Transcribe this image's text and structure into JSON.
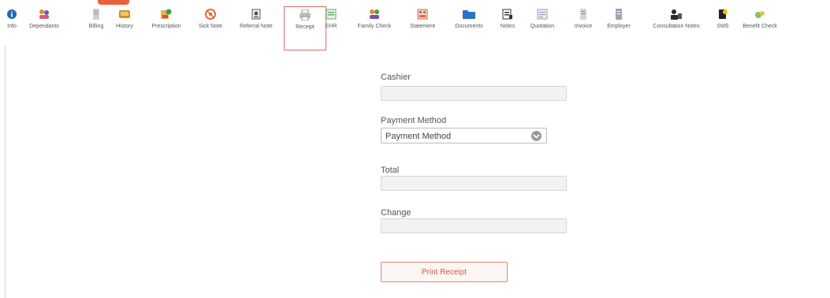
{
  "toolbar": {
    "items": [
      {
        "label": "Info",
        "icon": "info-icon"
      },
      {
        "label": "Dependants",
        "icon": "dependants-icon"
      },
      {
        "label": "Billing",
        "icon": "billing-icon"
      },
      {
        "label": "History",
        "icon": "history-icon"
      },
      {
        "label": "Prescription",
        "icon": "prescription-icon"
      },
      {
        "label": "Sick Note",
        "icon": "sick-note-icon"
      },
      {
        "label": "Referral Note",
        "icon": "referral-note-icon"
      },
      {
        "label": "Receipt",
        "icon": "receipt-icon"
      },
      {
        "label": "EHR",
        "icon": "ehr-icon"
      },
      {
        "label": "Family Check",
        "icon": "family-check-icon"
      },
      {
        "label": "Statement",
        "icon": "statement-icon"
      },
      {
        "label": "Documents",
        "icon": "documents-icon"
      },
      {
        "label": "Notes",
        "icon": "notes-icon"
      },
      {
        "label": "Quotation",
        "icon": "quotation-icon"
      },
      {
        "label": "Invoice",
        "icon": "invoice-icon"
      },
      {
        "label": "Employer",
        "icon": "employer-icon"
      },
      {
        "label": "Consultation Notes",
        "icon": "consultation-notes-icon"
      },
      {
        "label": "SMS",
        "icon": "sms-icon"
      },
      {
        "label": "Benefit Check",
        "icon": "benefit-check-icon"
      }
    ],
    "active": "Receipt"
  },
  "form": {
    "cashier_label": "Cashier",
    "cashier_value": "",
    "payment_method_label": "Payment Method",
    "payment_method_selected": "Payment Method",
    "total_label": "Total",
    "total_value": "",
    "change_label": "Change",
    "change_value": "",
    "print_button": "Print Receipt"
  },
  "colors": {
    "accent": "#e0533a",
    "active_border": "#e36b6b",
    "input_bg": "#f2f2f2"
  }
}
